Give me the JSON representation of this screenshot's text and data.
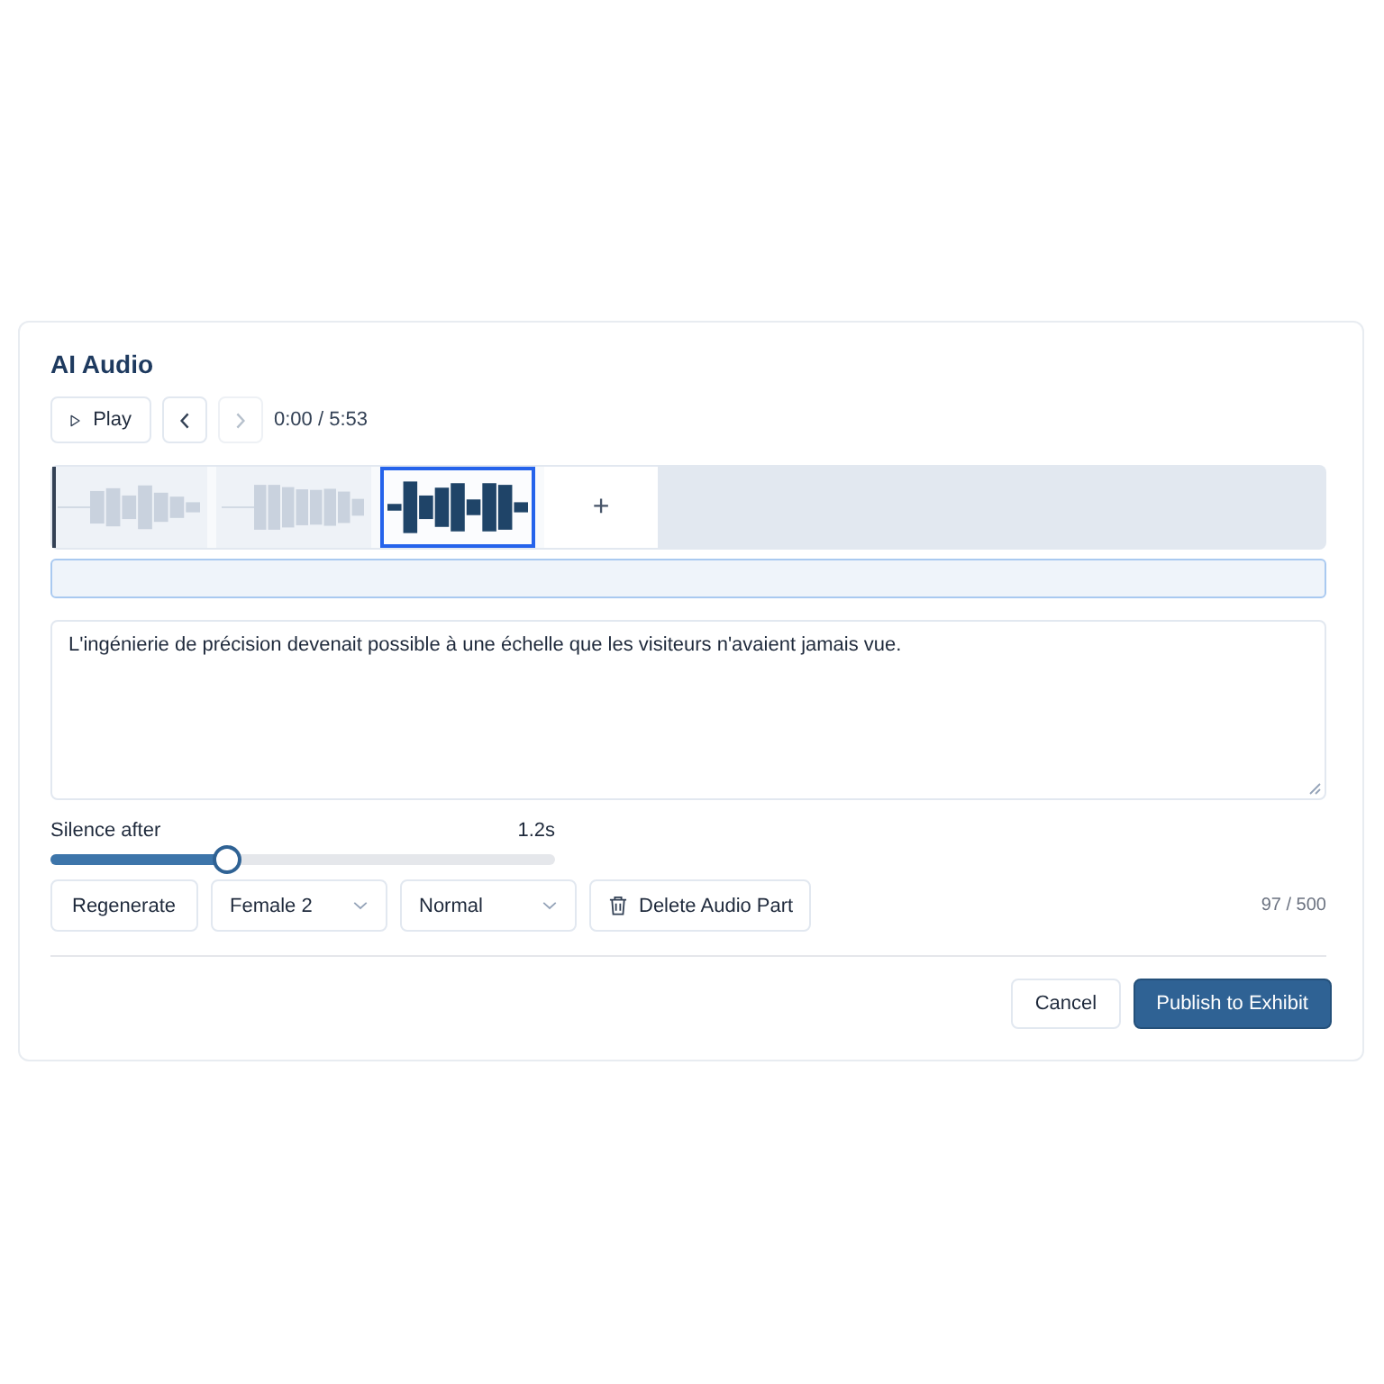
{
  "panel": {
    "title": "AI Audio"
  },
  "player": {
    "play_label": "Play",
    "previous_disabled": false,
    "next_disabled": true,
    "time": "0:00 / 5:53"
  },
  "timeline": {
    "segments": [
      {
        "selected": false
      },
      {
        "selected": false
      },
      {
        "selected": true
      }
    ],
    "add_label": "+"
  },
  "text": {
    "value": "L'ingénierie de précision devenait possible à une échelle que les visiteurs n'avaient jamais vue."
  },
  "silence": {
    "label": "Silence after",
    "reading": "1.2s",
    "level": 0.34
  },
  "actions": [
    {
      "kind": "button",
      "label": "Regenerate"
    },
    {
      "kind": "dropdown",
      "value": "Female 2"
    },
    {
      "kind": "dropdown",
      "value": "Normal"
    },
    {
      "kind": "delete",
      "label": "Delete Audio Part"
    }
  ],
  "char_count": "97 / 500",
  "footer": {
    "buttons": [
      {
        "kind": "secondary",
        "label": "Cancel"
      },
      {
        "kind": "primary",
        "label": "Publish to Exhibit"
      }
    ]
  }
}
